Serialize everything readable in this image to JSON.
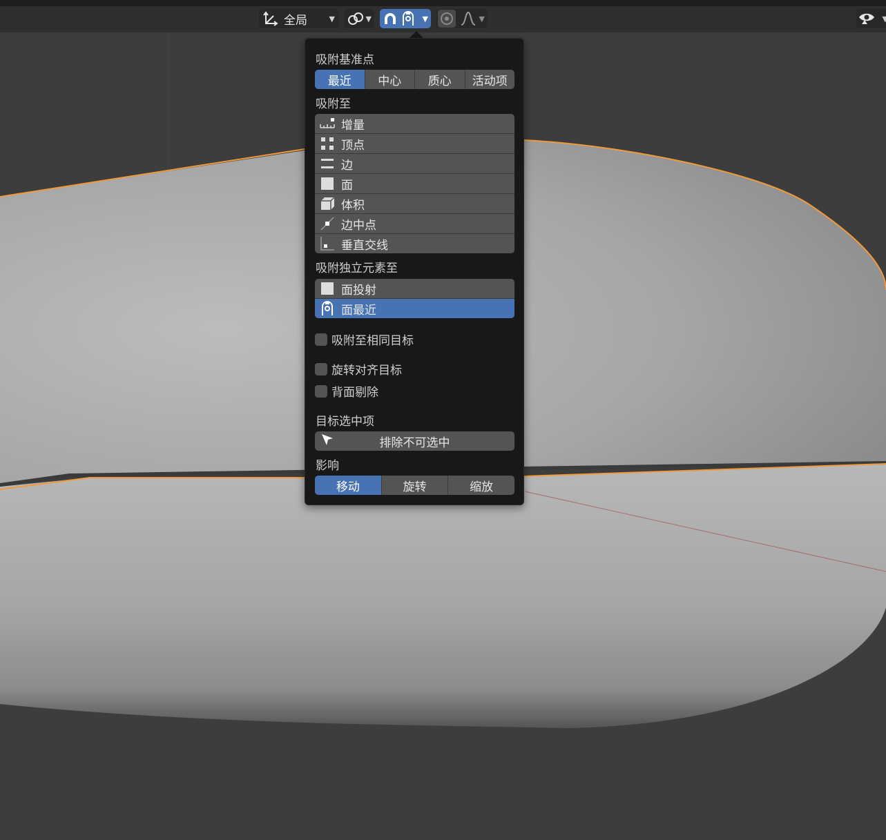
{
  "header": {
    "orientation_label": "全局",
    "icons": {
      "orientation": "transform-orientation-icon",
      "pivot": "pivot-point-icon",
      "snap": "snap-magnet-icon",
      "snap_target": "snap-face-nearest-icon",
      "proportional": "proportional-editing-icon",
      "falloff": "falloff-curve-icon",
      "overlay": "visibility-eye-icon"
    }
  },
  "panel": {
    "snap_base": {
      "label": "吸附基准点",
      "options": [
        "最近",
        "中心",
        "质心",
        "活动项"
      ],
      "selected": "最近"
    },
    "snap_to": {
      "label": "吸附至",
      "items": [
        {
          "label": "增量",
          "icon": "increment-icon"
        },
        {
          "label": "顶点",
          "icon": "vertex-icon"
        },
        {
          "label": "边",
          "icon": "edge-icon"
        },
        {
          "label": "面",
          "icon": "face-icon"
        },
        {
          "label": "体积",
          "icon": "volume-icon"
        },
        {
          "label": "边中点",
          "icon": "edge-midpoint-icon"
        },
        {
          "label": "垂直交线",
          "icon": "perpendicular-icon"
        }
      ]
    },
    "snap_individual": {
      "label": "吸附独立元素至",
      "items": [
        {
          "label": "面投射",
          "icon": "face-project-icon",
          "active": false
        },
        {
          "label": "面最近",
          "icon": "face-nearest-icon",
          "active": true
        }
      ]
    },
    "checks": {
      "same_target": "吸附至相同目标",
      "align_rotation": "旋转对齐目标",
      "backface_culling": "背面剔除"
    },
    "target_selection": {
      "label": "目标选中项",
      "value": "排除不可选中"
    },
    "affect": {
      "label": "影响",
      "options": [
        "移动",
        "旋转",
        "缩放"
      ],
      "selected": "移动"
    }
  },
  "colors": {
    "accent": "#4772b3",
    "selection_outline": "#f09a3a",
    "panel_bg": "#181818",
    "button_bg": "#545454",
    "viewport_bg": "#3d3d3d"
  }
}
